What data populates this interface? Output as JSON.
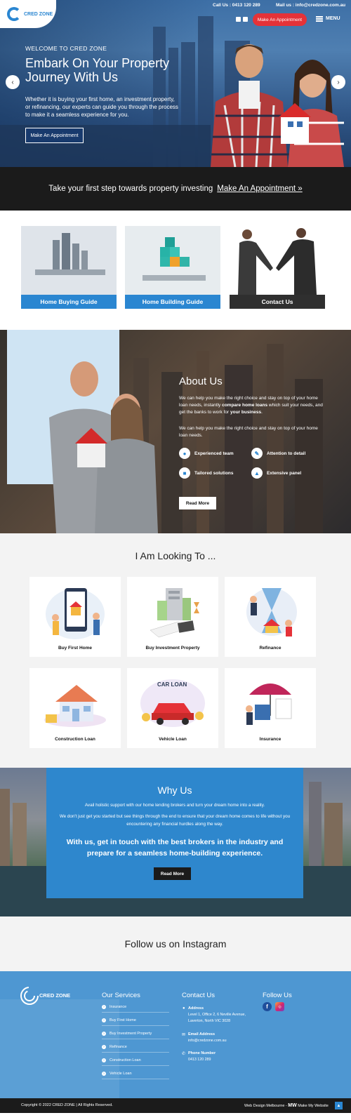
{
  "header": {
    "logo_text": "CRED ZONE",
    "call_label": "Call Us : 0413 120 289",
    "mail_label": "Mail us : info@credzone.com.au",
    "appointment_button": "Make An Appointment",
    "menu_label": "MENU"
  },
  "hero": {
    "welcome": "WELCOME TO CRED ZONE",
    "title": "Embark On Your Property Journey With Us",
    "description": "Whether it is buying your first home, an investment property, or refinancing, our experts can guide you through the process to make it a seamless experience for you.",
    "button": "Make An Appointment",
    "prev_arrow": "‹",
    "next_arrow": "›"
  },
  "cta": {
    "text": "Take your first step towards property investing",
    "link": "Make An Appointment »"
  },
  "guides": [
    {
      "label": "Home Buying Guide",
      "color": "#2a86d1"
    },
    {
      "label": "Home Building Guide",
      "color": "#2a86d1"
    },
    {
      "label": "Contact Us",
      "color": "#2f2f2f"
    }
  ],
  "about": {
    "heading": "About Us",
    "para1_a": "We can help you make the right choice and stay on top of your home loan needs, instantly ",
    "para1_b": "compare home loans",
    "para1_c": " which suit your needs, and get the banks to work for ",
    "para1_d": "your business",
    "para1_e": ".",
    "para2": "We can help you make the right choice and stay on top of your home loan needs.",
    "features": [
      "Experienced team",
      "Attention to detail",
      "Tailored solutions",
      "Extensive panel"
    ],
    "button": "Read More"
  },
  "looking": {
    "heading": "I Am Looking To ...",
    "cards": [
      {
        "label": "Buy First Home"
      },
      {
        "label": "Buy Investment Property"
      },
      {
        "label": "Refinance"
      },
      {
        "label": "Construction Loan"
      },
      {
        "label": "Vehicle Loan",
        "badge": "CAR LOAN"
      },
      {
        "label": "Insurance"
      }
    ]
  },
  "why": {
    "heading": "Why Us",
    "p1": "Avail holistic support with our home lending brokers and turn your dream home into a reality.",
    "p2": "We don't just get you started but see things through the end to ensure that your dream home comes to life without you encountering any financial hurdles along the way.",
    "big": "With us, get in touch with the best brokers in the industry and prepare for a seamless home-building experience.",
    "button": "Read More"
  },
  "instagram": {
    "heading": "Follow us on Instagram"
  },
  "footer": {
    "logo_text": "CRED ZONE",
    "services_heading": "Our Services",
    "services": [
      "Insurance",
      "Buy First Home",
      "Buy Investment Property",
      "Refinance",
      "Construction Loan",
      "Vehicle Loan"
    ],
    "contact_heading": "Contact Us",
    "address_label": "Address",
    "address_value": "Level 1, Office 2, 6 Neville Avenue, Laverton, North VIC 3028",
    "email_label": "Email Address",
    "email_value": "info@credzone.com.au",
    "phone_label": "Phone Number",
    "phone_value": "0413 120 289",
    "follow_heading": "Follow Us",
    "social": [
      "f",
      "ig"
    ]
  },
  "copyright": {
    "left": "Copyright © 2022 CRED ZONE | All Rights Reserved.",
    "right_a": "Web Design Melbourne -",
    "right_b": "Make My Website",
    "up": "▲"
  }
}
